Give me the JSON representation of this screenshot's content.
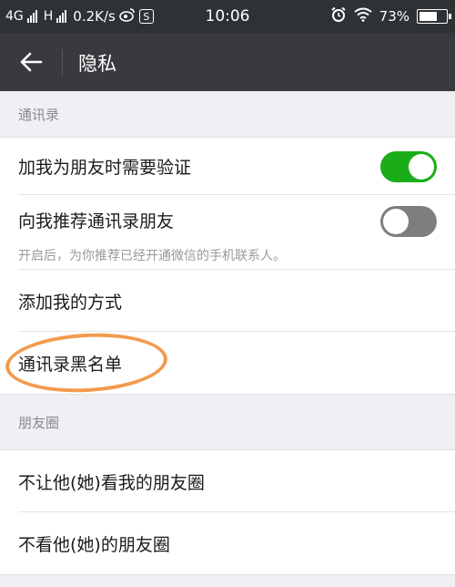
{
  "status_bar": {
    "network_1": "4G",
    "network_2": "H",
    "speed": "0.2K/s",
    "time": "10:06",
    "battery": "73%",
    "battery_level": 0.73,
    "icons": [
      "signal-icon",
      "weibo-icon",
      "notification-icon",
      "alarm-icon",
      "wifi-icon",
      "battery-icon"
    ]
  },
  "header": {
    "title": "隐私",
    "back_icon": "arrow-left-icon"
  },
  "sections": {
    "contacts": {
      "header": "通讯录",
      "items": [
        {
          "label": "加我为朋友时需要验证",
          "toggle": true
        },
        {
          "label": "向我推荐通讯录朋友",
          "toggle": false,
          "description": "开启后，为你推荐已经开通微信的手机联系人。"
        },
        {
          "label": "添加我的方式"
        },
        {
          "label": "通讯录黑名单",
          "highlighted": true
        }
      ]
    },
    "moments": {
      "header": "朋友圈",
      "items": [
        {
          "label": "不让他(她)看我的朋友圈"
        },
        {
          "label": "不看他(她)的朋友圈"
        }
      ]
    }
  },
  "colors": {
    "toggle_on": "#1aad19",
    "toggle_off": "#7e7e7e",
    "highlight_circle": "#f39a4d",
    "title_bar": "#393a3f"
  }
}
